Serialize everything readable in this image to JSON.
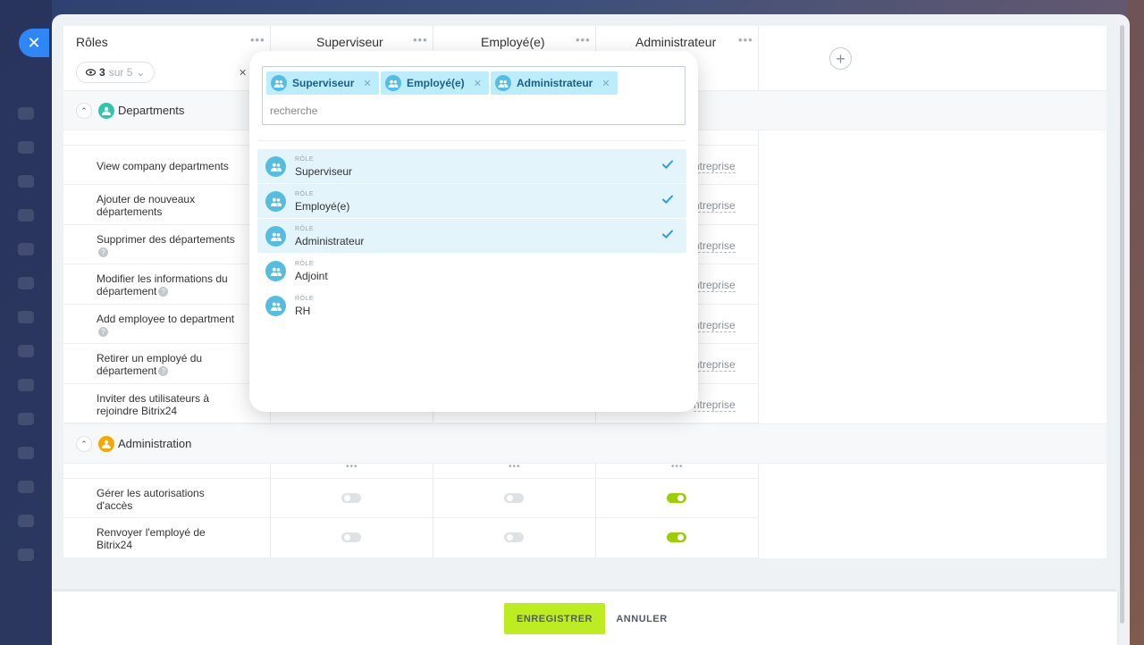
{
  "header": {
    "roles_title": "Rôles",
    "columns": [
      "Superviseur",
      "Employé(e)",
      "Administrateur"
    ],
    "counter": {
      "value": "3",
      "suffix": "sur 5"
    }
  },
  "sections": {
    "departments": {
      "title": "Departments",
      "rows": [
        {
          "label": "View company departments",
          "scope": "ntreprise"
        },
        {
          "label": "Ajouter de nouveaux départements",
          "scope": "ntreprise"
        },
        {
          "label": "Supprimer des départements",
          "scope": "ntreprise"
        },
        {
          "label": "Modifier les informations du département",
          "scope": "ntreprise"
        },
        {
          "label": "Add employee to department",
          "scope": "ntreprise"
        },
        {
          "label": "Retirer un employé du département",
          "scope": "ntreprise"
        },
        {
          "label": "Inviter des utilisateurs à rejoindre Bitrix24",
          "scope": "ntreprise"
        }
      ]
    },
    "administration": {
      "title": "Administration",
      "rows": [
        {
          "label": "Gérer les autorisations d'accès",
          "toggles": [
            false,
            false,
            true
          ]
        },
        {
          "label": "Renvoyer l'employé de Bitrix24",
          "toggles": [
            false,
            false,
            true
          ]
        }
      ]
    }
  },
  "popup": {
    "tags": [
      "Superviseur",
      "Employé(e)",
      "Administrateur"
    ],
    "search_placeholder": "recherche",
    "option_type": "RÔLE",
    "options": [
      {
        "name": "Superviseur",
        "selected": true
      },
      {
        "name": "Employé(e)",
        "selected": true
      },
      {
        "name": "Administrateur",
        "selected": true
      },
      {
        "name": "Adjoint",
        "selected": false
      },
      {
        "name": "RH",
        "selected": false
      }
    ]
  },
  "footer": {
    "save_label": "ENREGISTRER",
    "cancel_label": "ANNULER"
  },
  "colors": {
    "accent_blue": "#2f86f6",
    "save_green": "#bbed21",
    "toggle_on": "#9dcf00",
    "tag_bg": "#bcedfc",
    "role_icon": "#55bde0"
  }
}
